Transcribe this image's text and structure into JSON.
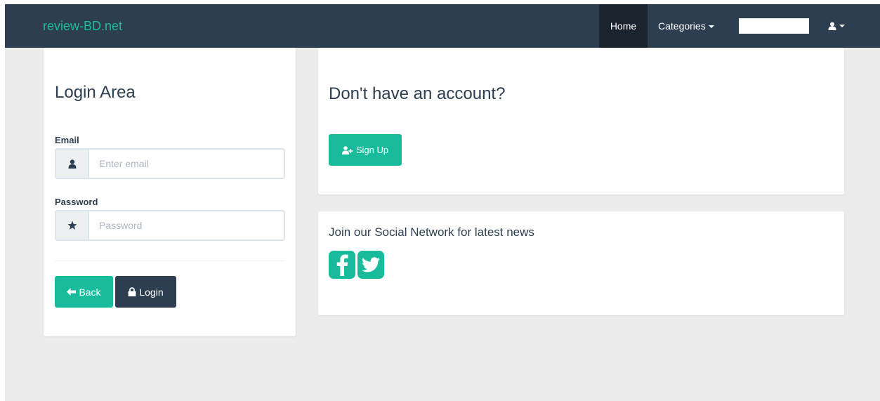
{
  "navbar": {
    "brand": "review-BD.net",
    "home_label": "Home",
    "categories_label": "Categories",
    "search_placeholder": "",
    "user_menu_icon": "user-icon"
  },
  "login": {
    "title": "Login Area",
    "email_label": "Email",
    "email_placeholder": "Enter email",
    "email_icon": "user-icon",
    "password_label": "Password",
    "password_placeholder": "Password",
    "password_icon": "star-icon",
    "back_label": "Back",
    "login_label": "Login"
  },
  "signup": {
    "title": "Don't have an account?",
    "button_label": "Sign Up"
  },
  "social": {
    "title": "Join our Social Network for latest news",
    "icons": [
      "facebook-icon",
      "twitter-icon"
    ]
  },
  "colors": {
    "navbar": "#2c3e50",
    "accent": "#18bc9c",
    "dark_button": "#2c3e50",
    "background": "#ececec"
  }
}
